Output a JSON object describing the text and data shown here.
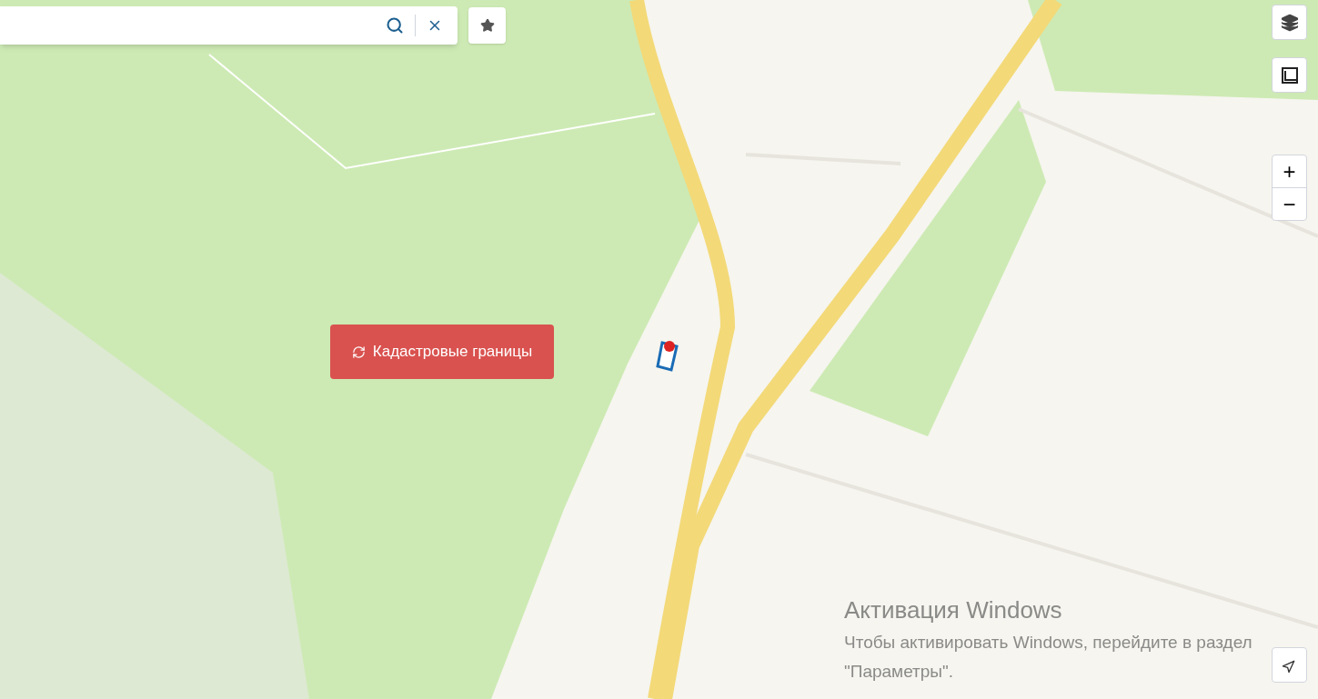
{
  "cadastral_button": {
    "label": "Кадастровые границы"
  },
  "zoom": {
    "in": "+",
    "out": "−"
  },
  "os_notice": {
    "title": "Активация Windows",
    "text": "Чтобы активировать Windows, перейдите в раздел \"Параметры\"."
  }
}
